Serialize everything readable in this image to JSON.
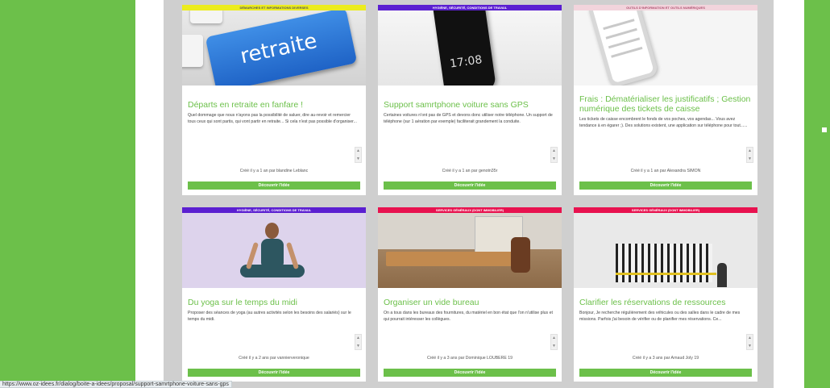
{
  "cards": [
    {
      "category": "Démarches et informations diverses",
      "cat_color": "#ecec1e",
      "title": "Départs en retraite en fanfare !",
      "desc": "Quel dommage que nous n'ayons pas la possibilité de saluer, dire au-revoir et remercier tous ceux qui sont partis, qui vont partir en retraite... Si cela n'est pas possible d'organiser...",
      "meta": "Créé il y a 1 an par blandine Leblanc",
      "button": "Découvrir l'idée",
      "image_text": "retraite"
    },
    {
      "category": "Hygiène, sécurité, conditions de travail",
      "cat_color": "#5b1fd1",
      "title": "Support samrtphone voiture sans GPS",
      "desc": "Certaines voitures n'ont pas de GPS et devons donc utiliser notre téléphone. Un support de téléphone (sur 1 aération par exemple) faciliterait grandement la conduite.",
      "meta": "Créé il y a 1 an par genotn35r",
      "button": "Découvrir l'idée",
      "image_text": "17:08"
    },
    {
      "category": "Outils d'information et outils numériques",
      "cat_color": "#f2d4dc",
      "title": "Frais : Dématérialiser les justificatifs ; Gestion numérique des tickets de caisse",
      "desc": "Les tickets de caisse encombrent le fonds de vos poches, vos agendas... Vous avez tendance à en égarer ;). Des solutions existent, une application sur téléphone pour tout......",
      "meta": "Créé il y a 1 an par Alexandra SIMON",
      "button": "Découvrir l'idée"
    },
    {
      "category": "Hygiène, sécurité, conditions de travail",
      "cat_color": "#5b1fd1",
      "title": "Du yoga sur le temps du midi",
      "desc": "Proposer des séances de yoga (au autres activités selon les besoins des salariés) sur le temps du midi.",
      "meta": "Créé il y a 2 ans par vannierveronique",
      "button": "Découvrir l'idée"
    },
    {
      "category": "Services généraux (dont immobilier)",
      "cat_color": "#e8124f",
      "title": "Organiser un vide bureau",
      "desc": "On a tous dans les bureaux des fournitures, du matériel en bon état que l'on n'utilise plus et qui pourrait intéresser les collègues.",
      "meta": "Créé il y a 3 ans par Dominique LOUBERE 19",
      "button": "Découvrir l'idée"
    },
    {
      "category": "Services généraux (dont immobilier)",
      "cat_color": "#e8124f",
      "title": "Clarifier les réservations de ressources",
      "desc": "Bonjour, Je recherche régulièrement des véhicules ou des salles dans le cadre de mes missions. Parfois j'ai besoin de vérifier ou de planifier mes réservations. Ce...",
      "meta": "Créé il y a 3 ans par Arnaud Joly 19",
      "button": "Découvrir l'idée"
    }
  ],
  "status_url": "https://www.oz-idees.fr/dialog/boite-a-idees/proposal/support-samrtphone-voiture-sans-gps",
  "colors": {
    "accent": "#6cc04a",
    "grey": "#cfcfcf"
  }
}
